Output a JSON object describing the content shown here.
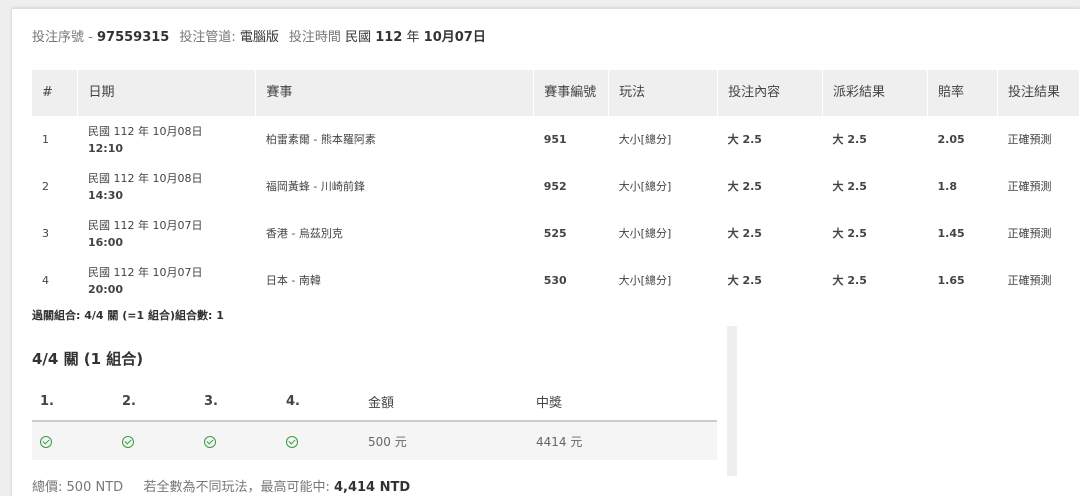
{
  "meta": {
    "serial_label": "投注序號",
    "serial_sep": " - ",
    "serial": "97559315",
    "channel_label": "投注管道:",
    "channel": "電腦版",
    "time_label": "投注時間",
    "time_prefix": "民國",
    "time_year": "112",
    "time_year_unit": "年",
    "time_date": "10月07日"
  },
  "table": {
    "headers": [
      "#",
      "日期",
      "賽事",
      "賽事編號",
      "玩法",
      "投注內容",
      "派彩結果",
      "賠率",
      "投注結果"
    ],
    "rows": [
      {
        "idx": "1",
        "date": "民國 112 年 10月08日",
        "time": "12:10",
        "match": "柏雷素爾 - 熊本羅阿素",
        "code": "951",
        "play": "大小[總分]",
        "bet": "大 2.5",
        "result": "大 2.5",
        "odds": "2.05",
        "outcome": "正確預測"
      },
      {
        "idx": "2",
        "date": "民國 112 年 10月08日",
        "time": "14:30",
        "match": "福岡黃蜂 - 川崎前鋒",
        "code": "952",
        "play": "大小[總分]",
        "bet": "大 2.5",
        "result": "大 2.5",
        "odds": "1.8",
        "outcome": "正確預測"
      },
      {
        "idx": "3",
        "date": "民國 112 年 10月07日",
        "time": "16:00",
        "match": "香港 - 烏茲別克",
        "code": "525",
        "play": "大小[總分]",
        "bet": "大 2.5",
        "result": "大 2.5",
        "odds": "1.45",
        "outcome": "正確預測"
      },
      {
        "idx": "4",
        "date": "民國 112 年 10月07日",
        "time": "20:00",
        "match": "日本 - 南韓",
        "code": "530",
        "play": "大小[總分]",
        "bet": "大 2.5",
        "result": "大 2.5",
        "odds": "1.65",
        "outcome": "正確預測"
      }
    ]
  },
  "combo_summary": "過關組合: 4/4 關 (=1 組合)組合數: 1",
  "parlay": {
    "title": "4/4 關 (1 組合)",
    "legs": [
      "1.",
      "2.",
      "3.",
      "4."
    ],
    "amount_label": "金額",
    "win_label": "中獎",
    "amount": "500 元",
    "win": "4414 元",
    "check_icon": "check-circle-icon",
    "check_color": "#3a9a45"
  },
  "footer": {
    "total_label": "總價:",
    "total": "500 NTD",
    "note": "若全數為不同玩法，最高可能中:",
    "max_win": "4,414 NTD"
  }
}
